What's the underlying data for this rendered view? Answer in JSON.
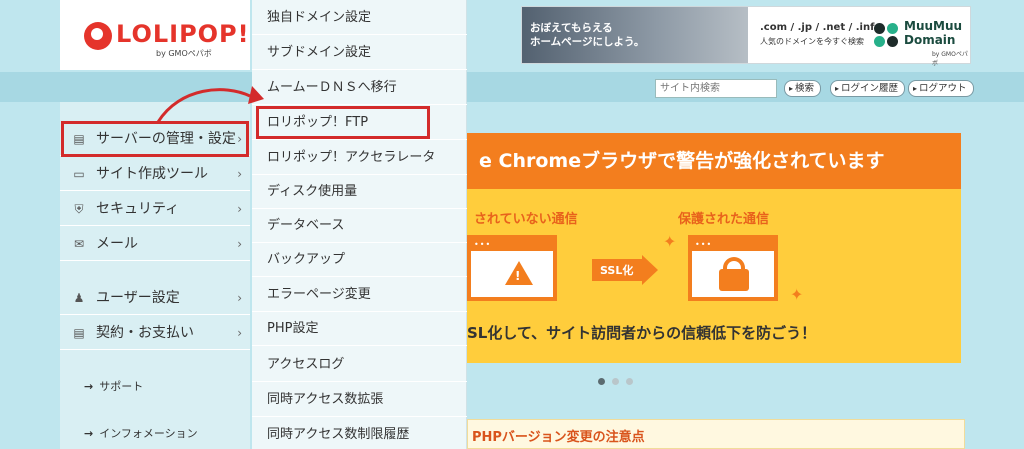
{
  "header": {
    "logo_text": "LOLIPOP!",
    "logo_sub": "by GMOペパボ",
    "banner": {
      "copy_line1": "おぼえてもらえる",
      "copy_line2": "ホームページにしよう。",
      "domains": ".com / .jp / .net / .info",
      "domains_sub": "人気のドメインを今すぐ検索",
      "brand_line1": "MuuMuu",
      "brand_line2": "Domain",
      "brand_sub": "by GMOペパボ"
    }
  },
  "topbar": {
    "search_placeholder": "サイト内検索",
    "search_button": "検索",
    "login_history": "ログイン履歴",
    "logout": "ログアウト"
  },
  "sidebar": {
    "items": [
      {
        "label": "サーバーの管理・設定",
        "icon": "server-icon"
      },
      {
        "label": "サイト作成ツール",
        "icon": "laptop-icon"
      },
      {
        "label": "セキュリティ",
        "icon": "shield-icon"
      },
      {
        "label": "メール",
        "icon": "mail-icon"
      },
      {
        "label": "ユーザー設定",
        "icon": "user-icon"
      },
      {
        "label": "契約・お支払い",
        "icon": "card-icon"
      }
    ],
    "links": [
      "サポート",
      "インフォメーション"
    ],
    "chevron": "›"
  },
  "dropdown": {
    "items": [
      "独自ドメイン設定",
      "サブドメイン設定",
      "ムームーＤＮＳへ移行",
      "ロリポップ！FTP",
      "ロリポップ！アクセラレータ",
      "ディスク使用量",
      "データベース",
      "バックアップ",
      "エラーページ変更",
      "PHP設定",
      "アクセスログ",
      "同時アクセス数拡張",
      "同時アクセス数制限履歴"
    ]
  },
  "main": {
    "banner_title": "e Chromeブラウザで警告が強化されています",
    "left_label": "されていない通信",
    "right_label": "保護された通信",
    "ssl_label": "SSL化",
    "footer": "SL化して、サイト訪問者からの信頼低下を防ごう！",
    "carousel_dots": 3,
    "notice": "PHPバージョン変更の注意点"
  },
  "colors": {
    "accent_red": "#d32b2b",
    "orange": "#f37e1e",
    "yellow": "#ffcd3c",
    "page_bg": "#bfe6ee"
  }
}
